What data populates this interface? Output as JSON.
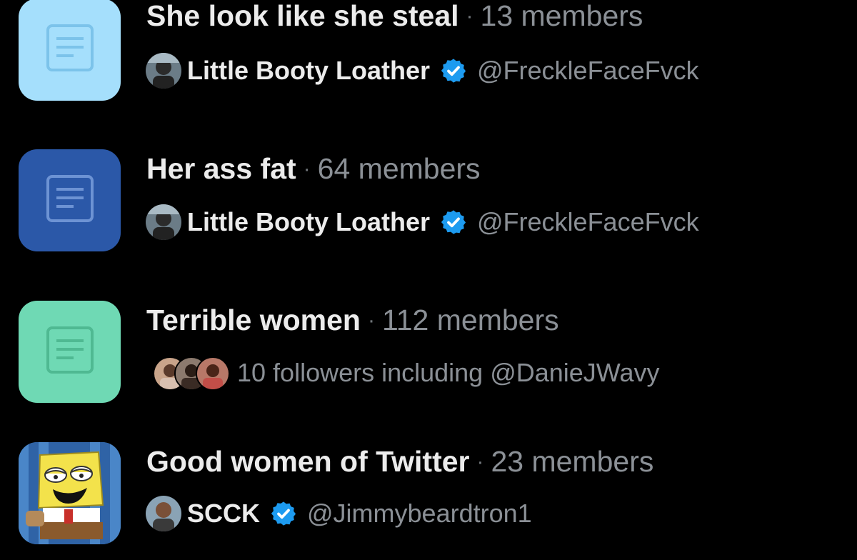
{
  "lists": [
    {
      "title": "She look like she steal",
      "separator": "·",
      "members": "13 members",
      "owner_name": "Little Booty Loather",
      "owner_handle": "@FreckleFaceFvck",
      "verified": true,
      "icon": "document-icon",
      "icon_bg": "#a5dffc",
      "icon_fg": "#7cc3ea"
    },
    {
      "title": "Her ass fat",
      "separator": "·",
      "members": "64 members",
      "owner_name": "Little Booty Loather",
      "owner_handle": "@FreckleFaceFvck",
      "verified": true,
      "icon": "document-icon",
      "icon_bg": "#2b58a8",
      "icon_fg": "#6d93d4"
    },
    {
      "title": "Terrible women",
      "separator": "·",
      "members": "112 members",
      "followers_text": "10 followers including @DanieJWavy",
      "icon": "document-icon",
      "icon_bg": "#6fd9b4",
      "icon_fg": "#4fb992"
    },
    {
      "title": "Good women of Twitter",
      "separator": "·",
      "members": "23 members",
      "owner_name": "SCCK",
      "owner_handle": "@Jimmybeardtron1",
      "verified": true,
      "icon": "spongebob-image-icon"
    }
  ],
  "colors": {
    "background": "#000000",
    "primary_text": "#ececec",
    "secondary_text": "#8b9096",
    "verified_blue": "#1d9bf0"
  }
}
